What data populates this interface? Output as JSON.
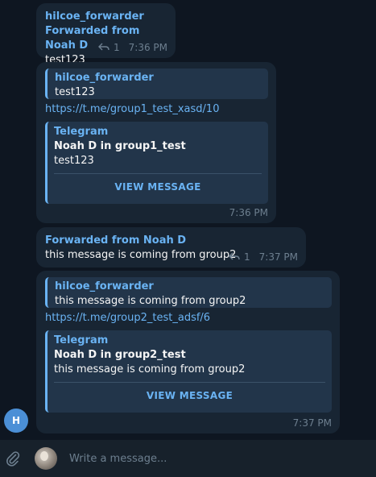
{
  "messages": [
    {
      "sender": "hilcoe_forwarder",
      "forwarded": "Forwarded from Noah D",
      "text": "test123",
      "replies": "1",
      "time": "7:36 PM"
    },
    {
      "quote_sender": "hilcoe_forwarder",
      "quote_text": "test123",
      "link": "https://t.me/group1_test_xasd/10",
      "preview_site": "Telegram",
      "preview_title": "Noah D in group1_test",
      "preview_text": "test123",
      "preview_button": "VIEW MESSAGE",
      "time": "7:36 PM"
    },
    {
      "forwarded": "Forwarded from Noah D",
      "text": "this message is coming from group2",
      "replies": "1",
      "time": "7:37 PM"
    },
    {
      "quote_sender": "hilcoe_forwarder",
      "quote_text": "this message is coming from group2",
      "link": "https://t.me/group2_test_adsf/6",
      "preview_site": "Telegram",
      "preview_title": "Noah D in group2_test",
      "preview_text": "this message is coming from group2",
      "preview_button": "VIEW MESSAGE",
      "time": "7:37 PM"
    }
  ],
  "sender_avatar_initial": "H",
  "composer": {
    "placeholder": "Write a message..."
  },
  "colors": {
    "background": "#0e1621",
    "bubble": "#182533",
    "accent": "#6ab3f3",
    "muted": "#6d7f8f",
    "composer": "#17212b",
    "avatar": "#4b8fd6"
  },
  "icons": {
    "reply_count": "reply-icon",
    "attach": "paperclip-icon"
  }
}
